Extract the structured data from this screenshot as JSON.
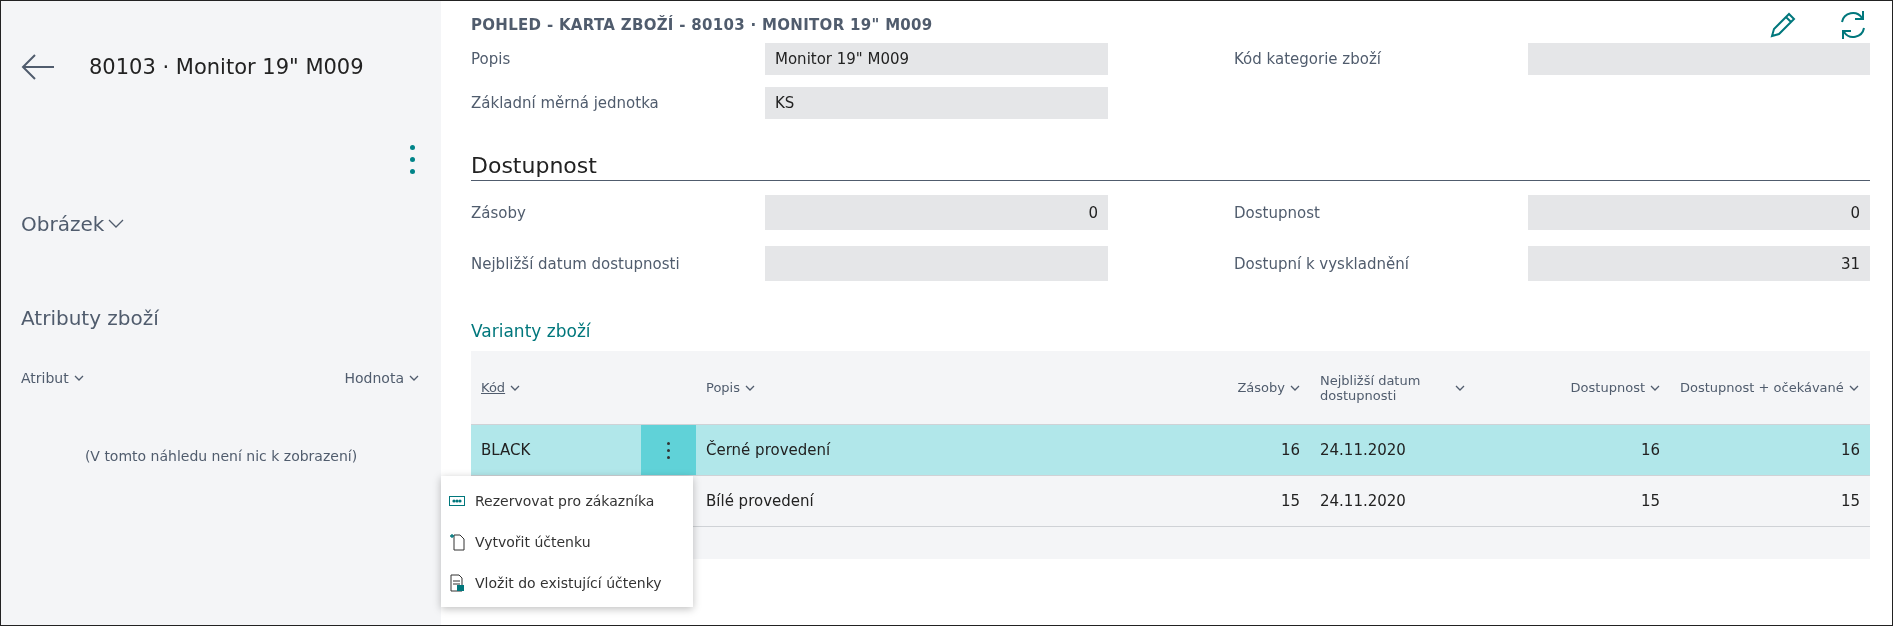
{
  "page_title": "POHLED - KARTA ZBOŽÍ - 80103 · MONITOR 19\" M009",
  "sidebar": {
    "title": "80103 · Monitor 19\" M009",
    "sections": [
      {
        "label": "Obrázek",
        "expanded": false
      },
      {
        "label": "Atributy zboží"
      }
    ],
    "attributes": {
      "columns": [
        "Atribut",
        "Hodnota"
      ],
      "empty_text": "(V tomto náhledu není nic k zobrazení)"
    }
  },
  "general_fields": [
    {
      "label": "Popis",
      "value": "Monitor 19\" M009"
    },
    {
      "label": "Kód kategorie zboží"
    },
    {
      "label": "Základní měrná jednotka",
      "value": "KS"
    }
  ],
  "availability": {
    "heading": "Dostupnost",
    "fields": [
      {
        "label": "Zásoby",
        "value": "0"
      },
      {
        "label": "Dostupnost",
        "value": "0"
      },
      {
        "label": "Nejbližší datum dostupnosti"
      },
      {
        "label": "Dostupní k vyskladnění",
        "value": "31"
      }
    ]
  },
  "variants": {
    "heading": "Varianty zboží",
    "columns": [
      "Kód",
      "Popis",
      "Zásoby",
      "Nejbližší datum dostupnosti",
      "Dostupnost",
      "Dostupnost + očekávané"
    ],
    "rows": [
      {
        "selected": true,
        "cells": [
          "BLACK",
          "Černé provedení",
          "16",
          "24.11.2020",
          "16",
          "16"
        ]
      },
      {
        "selected": false,
        "cells": [
          "",
          "Bílé provedení",
          "15",
          "24.11.2020",
          "15",
          "15"
        ]
      }
    ]
  },
  "context_menu": [
    {
      "label": "Rezervovat pro zákazníka",
      "kind": "reserve"
    },
    {
      "label": "Vytvořit účtenku",
      "kind": "new"
    },
    {
      "label": "Vložit do existující účtenky",
      "kind": "insert"
    }
  ]
}
